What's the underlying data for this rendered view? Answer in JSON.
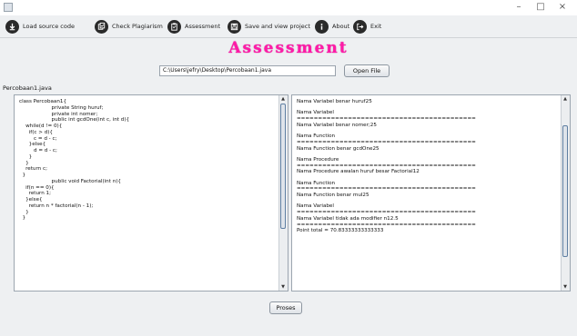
{
  "window": {
    "minimize": "–",
    "maximize": "□",
    "close": "×"
  },
  "menu": [
    {
      "label": "Load source code",
      "icon": "download-icon"
    },
    {
      "label": "Check Plagiarism",
      "icon": "copy-check-icon"
    },
    {
      "label": "Assessment",
      "icon": "clipboard-icon"
    },
    {
      "label": "Save and view project",
      "icon": "save-icon"
    },
    {
      "label": "About",
      "icon": "info-icon"
    },
    {
      "label": "Exit",
      "icon": "exit-icon"
    }
  ],
  "heading": "Assessment",
  "file": {
    "path": "C:\\Users\\jefry\\Desktop\\Percobaan1.java",
    "open_label": "Open File",
    "name_label": "Percobaan1.java"
  },
  "code_lines": [
    "class Percobaan1{",
    "                    private String huruf;",
    "                    private int nomer;",
    "",
    "                    public int gcdOne(int c, int d){",
    "    while(d != 0){",
    "      if(c > d){",
    "         c = d - c;",
    "      }else{",
    "         d = d - c;",
    "      }",
    "    }",
    "    return c;",
    "  }",
    "",
    "                    public void Factorial(int n){",
    "    if(n == 0){",
    "      return 1;",
    "    }else{",
    "      return n * factorial(n - 1);",
    "    }",
    "  }"
  ],
  "results": [
    [
      "Nama Variabel benar huruf25"
    ],
    [
      "Nama Variabel",
      "==========================================",
      "Nama Variabel benar nomer;25"
    ],
    [
      "Nama Function",
      "==========================================",
      "Nama Function benar gcdOne25"
    ],
    [
      "Nama Procedure",
      "==========================================",
      "Nama Procedure awalan huruf besar Factorial12"
    ],
    [
      "Nama Function",
      "==========================================",
      "Nama Function benar mul25"
    ],
    [
      "Nama Variabel",
      "==========================================",
      "Nama Variabel tidak ada modifier n12.5",
      "==========================================",
      "Point total = 70.83333333333333"
    ]
  ],
  "scroll_arrows": {
    "up": "▲",
    "down": "▼"
  },
  "proses_label": "Proses"
}
